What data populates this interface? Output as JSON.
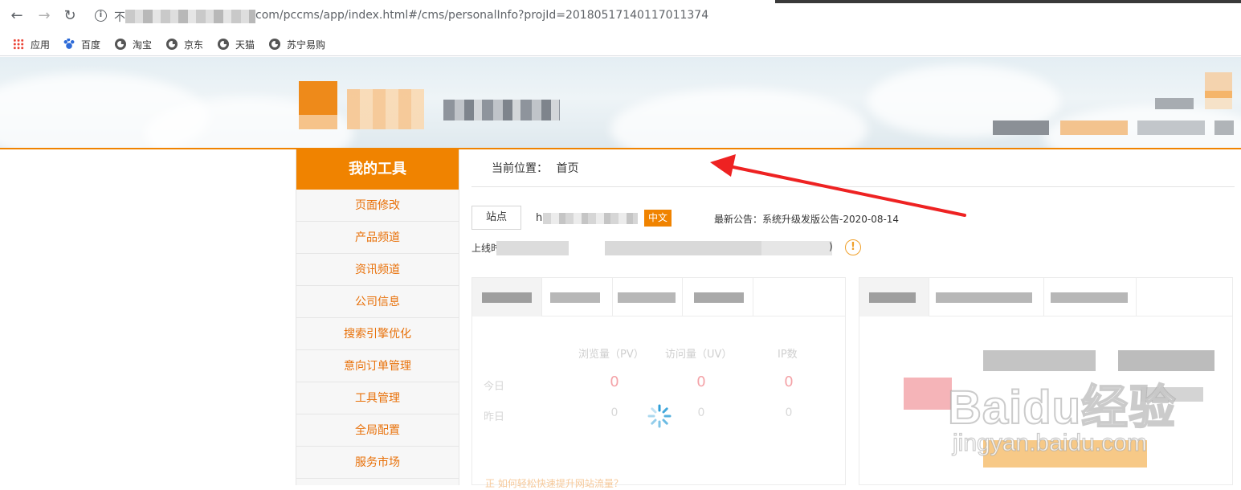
{
  "browser": {
    "url_prefix": "不",
    "url_text": "com/pccms/app/index.html#/cms/personalInfo?projId=20180517140117011374",
    "bookmarks": [
      {
        "label": "应用",
        "icon": "apps-grid-icon"
      },
      {
        "label": "百度",
        "icon": "baidu-paw-icon"
      },
      {
        "label": "淘宝",
        "icon": "globe-icon"
      },
      {
        "label": "京东",
        "icon": "globe-icon"
      },
      {
        "label": "天猫",
        "icon": "globe-icon"
      },
      {
        "label": "苏宁易购",
        "icon": "globe-icon"
      }
    ]
  },
  "sidebar": {
    "title": "我的工具",
    "items": [
      {
        "label": "页面修改"
      },
      {
        "label": "产品频道"
      },
      {
        "label": "资讯频道"
      },
      {
        "label": "公司信息"
      },
      {
        "label": "搜索引擎优化"
      },
      {
        "label": "意向订单管理"
      },
      {
        "label": "工具管理"
      },
      {
        "label": "全局配置"
      },
      {
        "label": "服务市场"
      }
    ]
  },
  "breadcrumb": {
    "label": "当前位置：",
    "current": "首页"
  },
  "site": {
    "button_label": "站点",
    "domain_initial": "h",
    "language_badge": "中文",
    "notice": "最新公告：系统升级发版公告-2020-08-14",
    "online_label": "上线时",
    "paren": ")"
  },
  "stats": {
    "headers": [
      "浏览量（PV）",
      "访问量（UV）",
      "IP数"
    ],
    "rows": [
      {
        "label": "今日",
        "values": [
          "0",
          "0",
          "0"
        ]
      },
      {
        "label": "昨日",
        "values": [
          "0",
          "0",
          "0"
        ]
      }
    ]
  },
  "footer_link": "正 如何轻松快速提升网站流量？",
  "watermark": {
    "brand": "Baidu经验",
    "url": "jingyan.baidu.com"
  },
  "colors": {
    "accent": "#f08300",
    "today_value": "#f4a3a8",
    "link": "#e8710a"
  }
}
